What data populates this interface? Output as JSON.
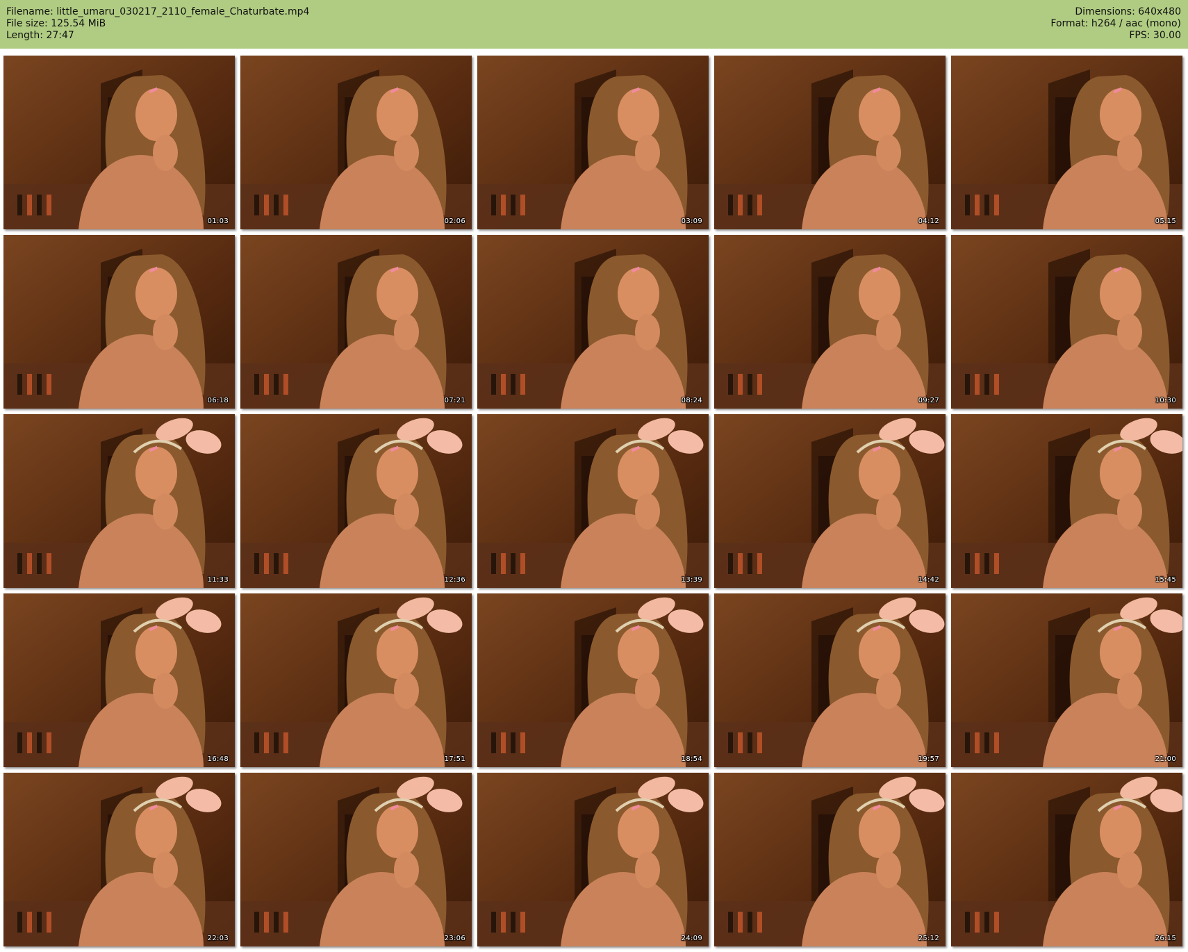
{
  "header": {
    "filename_line": "Filename: little_umaru_030217_2110_female_Chaturbate.mp4",
    "filesize_line": "File size: 125.54 MiB",
    "length_line": "Length: 27:47",
    "dimensions_line": "Dimensions: 640x480",
    "format_line": "Format: h264 / aac (mono)",
    "fps_line": "FPS: 30.00"
  },
  "colors": {
    "header_bg": "#b0cc82",
    "frame_bg": "#4a2510"
  },
  "thumbnails": [
    {
      "timestamp": "01:03",
      "ears": false
    },
    {
      "timestamp": "02:06",
      "ears": false
    },
    {
      "timestamp": "03:09",
      "ears": false
    },
    {
      "timestamp": "04:12",
      "ears": false
    },
    {
      "timestamp": "05:15",
      "ears": false
    },
    {
      "timestamp": "06:18",
      "ears": false
    },
    {
      "timestamp": "07:21",
      "ears": false
    },
    {
      "timestamp": "08:24",
      "ears": false
    },
    {
      "timestamp": "09:27",
      "ears": false
    },
    {
      "timestamp": "10:30",
      "ears": false
    },
    {
      "timestamp": "11:33",
      "ears": true
    },
    {
      "timestamp": "12:36",
      "ears": true
    },
    {
      "timestamp": "13:39",
      "ears": true
    },
    {
      "timestamp": "14:42",
      "ears": true
    },
    {
      "timestamp": "15:45",
      "ears": true
    },
    {
      "timestamp": "16:48",
      "ears": true
    },
    {
      "timestamp": "17:51",
      "ears": true
    },
    {
      "timestamp": "18:54",
      "ears": true
    },
    {
      "timestamp": "19:57",
      "ears": true
    },
    {
      "timestamp": "21:00",
      "ears": true
    },
    {
      "timestamp": "22:03",
      "ears": true
    },
    {
      "timestamp": "23:06",
      "ears": true
    },
    {
      "timestamp": "24:09",
      "ears": true
    },
    {
      "timestamp": "25:12",
      "ears": true
    },
    {
      "timestamp": "26:15",
      "ears": true
    }
  ]
}
